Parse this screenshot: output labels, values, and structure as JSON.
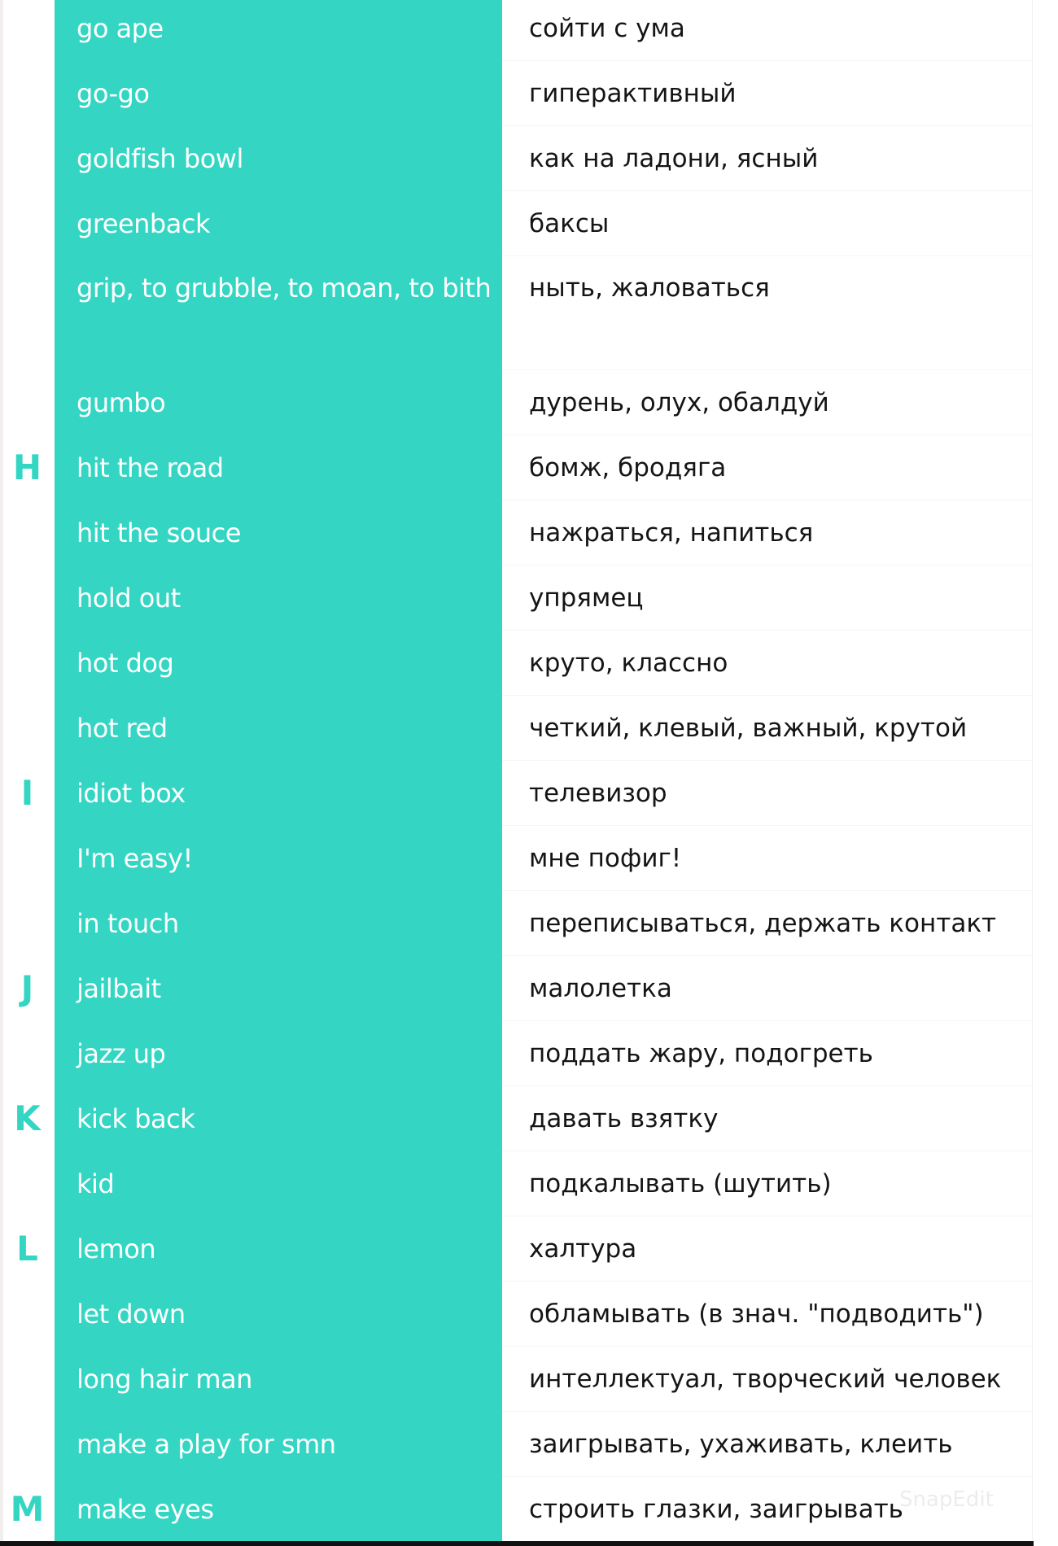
{
  "colors": {
    "accent": "#34d6c3",
    "text_dark": "#151515",
    "text_light": "#ffffff"
  },
  "watermark": "SnapEdit",
  "rows": [
    {
      "letter": "",
      "en": "go ape",
      "ru": "сойти с ума"
    },
    {
      "letter": "",
      "en": "go-go",
      "ru": "гиперактивный"
    },
    {
      "letter": "",
      "en": "goldfish bowl",
      "ru": "как на ладони, ясный"
    },
    {
      "letter": "",
      "en": "greenback",
      "ru": "баксы"
    },
    {
      "letter": "",
      "en": "grip, to grubble, to moan, to bith",
      "ru": "ныть, жаловаться",
      "double": true
    },
    {
      "letter": "",
      "en": "gumbo",
      "ru": "дурень, олух, обалдуй"
    },
    {
      "letter": "H",
      "en": "hit the road",
      "ru": "бомж, бродяга"
    },
    {
      "letter": "",
      "en": "hit the souce",
      "ru": "нажраться, напиться"
    },
    {
      "letter": "",
      "en": "hold out",
      "ru": "упрямец"
    },
    {
      "letter": "",
      "en": "hot dog",
      "ru": "круто, классно"
    },
    {
      "letter": "",
      "en": "hot red",
      "ru": "четкий, клевый, важный, крутой"
    },
    {
      "letter": "I",
      "en": "idiot box",
      "ru": "телевизор"
    },
    {
      "letter": "",
      "en": "I'm easy!",
      "ru": "мне пофиг!"
    },
    {
      "letter": "",
      "en": "in touch",
      "ru": "переписываться, держать контакт"
    },
    {
      "letter": "J",
      "en": "jailbait",
      "ru": "малолетка"
    },
    {
      "letter": "",
      "en": "jazz up",
      "ru": "поддать жару, подогреть"
    },
    {
      "letter": "K",
      "en": "kick back",
      "ru": "давать взятку"
    },
    {
      "letter": "",
      "en": "kid",
      "ru": "подкалывать (шутить)"
    },
    {
      "letter": "L",
      "en": "lemon",
      "ru": "халтура"
    },
    {
      "letter": "",
      "en": "let down",
      "ru": "обламывать (в знач. \"подводить\")"
    },
    {
      "letter": "",
      "en": "long hair man",
      "ru": "интеллектуал, творческий человек"
    },
    {
      "letter": "",
      "en": "make a play for smn",
      "ru": "заигрывать, ухаживать, клеить"
    },
    {
      "letter": "M",
      "en": "make eyes",
      "ru": "строить глазки, заигрывать"
    }
  ]
}
